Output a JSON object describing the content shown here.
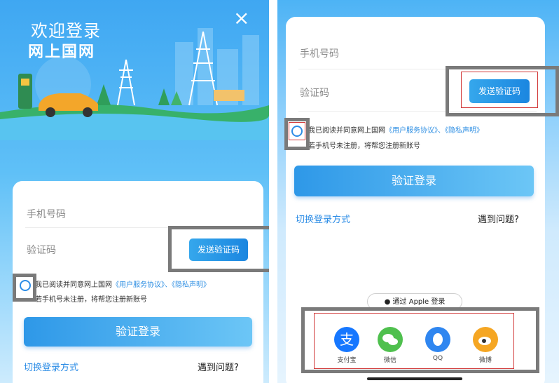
{
  "left": {
    "welcome": "欢迎登录",
    "app_name": "网上国网",
    "close_symbol": "×",
    "phone_placeholder": "手机号码",
    "code_placeholder": "验证码",
    "send_code_label": "发送验证码",
    "agree_prefix": "我已阅读并同意网上国网",
    "agree_link1": "《用户服务协议》",
    "agree_sep": "、",
    "agree_link2": "《隐私声明》",
    "agree_note": "若手机号未注册，将帮您注册新账号",
    "login_label": "验证登录",
    "switch_label": "切换登录方式",
    "problem_label": "遇到问题?"
  },
  "right": {
    "phone_placeholder": "手机号码",
    "code_placeholder": "验证码",
    "send_code_label": "发送验证码",
    "agree_prefix": "我已阅读并同意网上国网",
    "agree_link1": "《用户服务协议》",
    "agree_sep": "、",
    "agree_link2": "《隐私声明》",
    "agree_note": "若手机号未注册，将帮您注册新账号",
    "login_label": "验证登录",
    "switch_label": "切换登录方式",
    "problem_label": "遇到问题?",
    "apple_label": "通过 Apple 登录",
    "social": [
      {
        "label": "支付宝",
        "icon": "alipay-icon",
        "color": "#1677ff"
      },
      {
        "label": "微信",
        "icon": "wechat-icon",
        "color": "#4fc04e"
      },
      {
        "label": "QQ",
        "icon": "qq-icon",
        "color": "#2f86f0"
      },
      {
        "label": "微博",
        "icon": "weibo-icon",
        "color": "#f5a623"
      }
    ]
  },
  "colors": {
    "accent": "#2d8de6",
    "highlight_gray": "#7a7a7a",
    "highlight_red": "#d23a3a"
  }
}
